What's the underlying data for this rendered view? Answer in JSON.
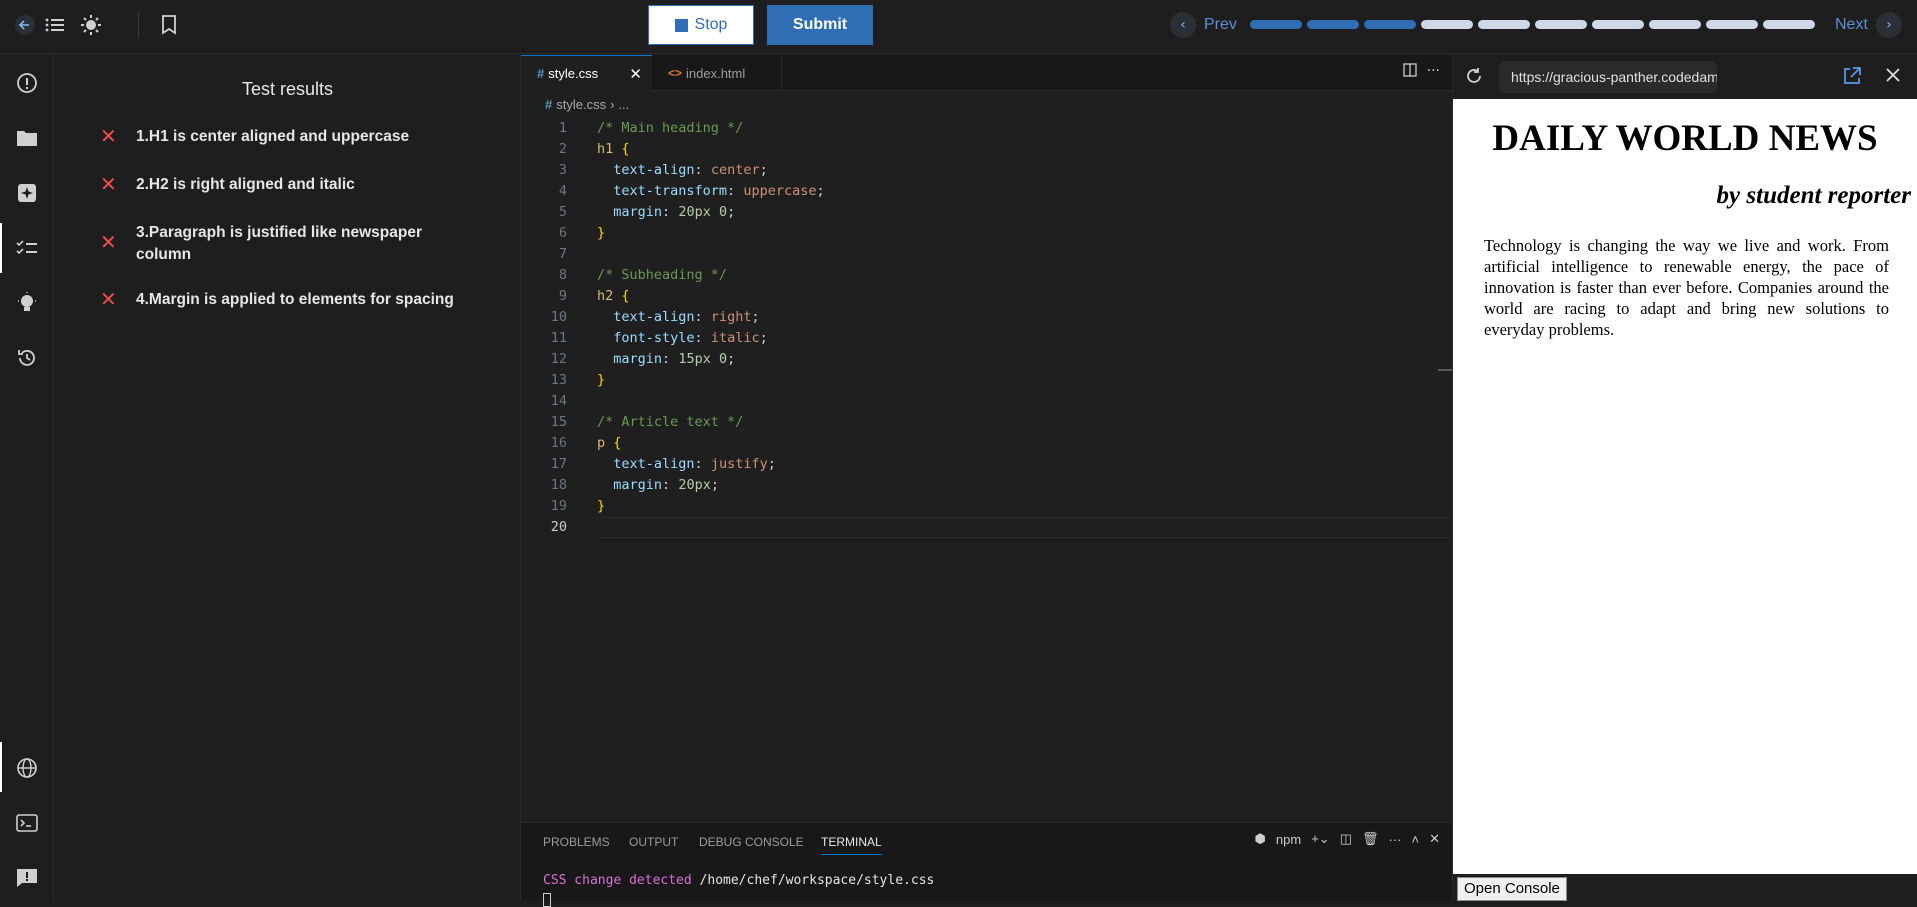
{
  "topbar": {
    "stop_label": "Stop",
    "submit_label": "Submit",
    "prev_label": "Prev",
    "next_label": "Next",
    "progress_total": 10,
    "progress_done": 3
  },
  "tests": {
    "title": "Test results",
    "items": [
      {
        "label": "1.H1 is center aligned and uppercase",
        "status": "fail"
      },
      {
        "label": "2.H2 is right aligned and italic",
        "status": "fail"
      },
      {
        "label": "3.Paragraph is justified like newspaper column",
        "status": "fail"
      },
      {
        "label": "4.Margin is applied to elements for spacing",
        "status": "fail"
      }
    ]
  },
  "editor": {
    "tabs": [
      {
        "icon": "#",
        "label": "style.css",
        "active": true
      },
      {
        "icon": "<>",
        "label": "index.html",
        "active": false
      }
    ],
    "breadcrumb": [
      "style.css",
      "..."
    ],
    "current_line": 20,
    "lines": [
      "/* Main heading */",
      "h1 {",
      "  text-align: center;",
      "  text-transform: uppercase;",
      "  margin: 20px 0;",
      "}",
      "",
      "/* Subheading */",
      "h2 {",
      "  text-align: right;",
      "  font-style: italic;",
      "  margin: 15px 0;",
      "}",
      "",
      "/* Article text */",
      "p {",
      "  text-align: justify;",
      "  margin: 20px;",
      "}",
      ""
    ]
  },
  "panel": {
    "tabs": [
      "PROBLEMS",
      "OUTPUT",
      "DEBUG CONSOLE",
      "TERMINAL"
    ],
    "active_tab": "TERMINAL",
    "shell_label": "npm",
    "terminal_msg": "CSS change detected",
    "terminal_path": "/home/chef/workspace/style.css"
  },
  "preview": {
    "url": "https://gracious-panther.codedamn.app",
    "h1": "Daily World News",
    "h2": "by student reporter",
    "paragraph": "Technology is changing the way we live and work. From artificial intelligence to renewable energy, the pace of innovation is faster than ever before. Companies around the world are racing to adapt and bring new solutions to everyday problems.",
    "console_button": "Open Console"
  },
  "colors": {
    "accent": "#2f6db5",
    "fail": "#f14c4c",
    "progress_pending": "#cfd8e6"
  }
}
